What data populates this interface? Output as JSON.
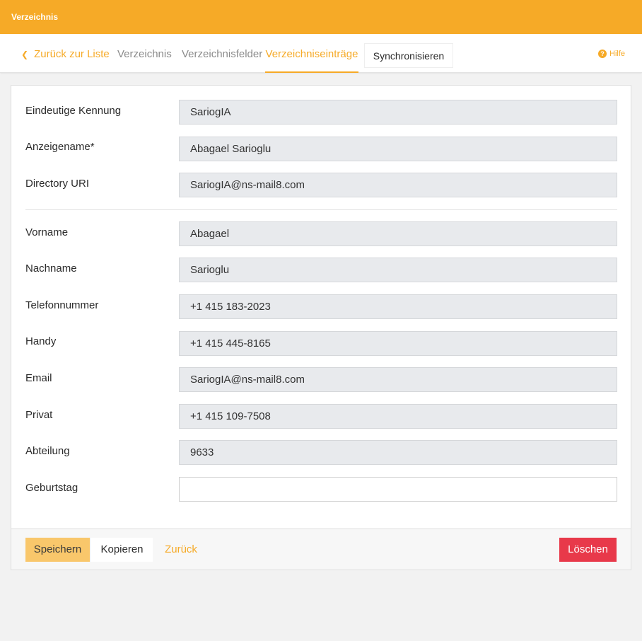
{
  "app": {
    "title": "Verzeichnis"
  },
  "nav": {
    "back_label": "Zurück zur Liste",
    "tabs": [
      "Verzeichnis",
      "Verzeichnisfelder",
      "Verzeichniseinträge"
    ],
    "sync_label": "Synchronisieren",
    "help_label": "Hilfe",
    "active_tab": "Verzeichniseinträge"
  },
  "form": {
    "fields": [
      {
        "label": "Eindeutige Kennung",
        "value": "SariogIA"
      },
      {
        "label": "Anzeigename*",
        "value": "Abagael Sarioglu"
      },
      {
        "label": "Directory URI",
        "value": "SariogIA@ns-mail8.com"
      },
      {
        "label": "Vorname",
        "value": "Abagael"
      },
      {
        "label": "Nachname",
        "value": "Sarioglu"
      },
      {
        "label": "Telefonnummer",
        "value": "+1 415 183-2023"
      },
      {
        "label": "Handy",
        "value": "+1 415 445-8165"
      },
      {
        "label": "Email",
        "value": "SariogIA@ns-mail8.com"
      },
      {
        "label": "Privat",
        "value": "+1 415 109-7508"
      },
      {
        "label": "Abteilung",
        "value": "9633"
      },
      {
        "label": "Geburtstag",
        "value": ""
      }
    ]
  },
  "actions": {
    "save_label": "Speichern",
    "copy_label": "Kopieren",
    "back_label": "Zurück",
    "delete_label": "Löschen"
  },
  "colors": {
    "accent": "#f6aa27",
    "delete": "#e8394a",
    "save_disabled": "#f9c76b"
  },
  "icons": {
    "back": "chevron-left-icon",
    "help": "question-circle-icon"
  }
}
